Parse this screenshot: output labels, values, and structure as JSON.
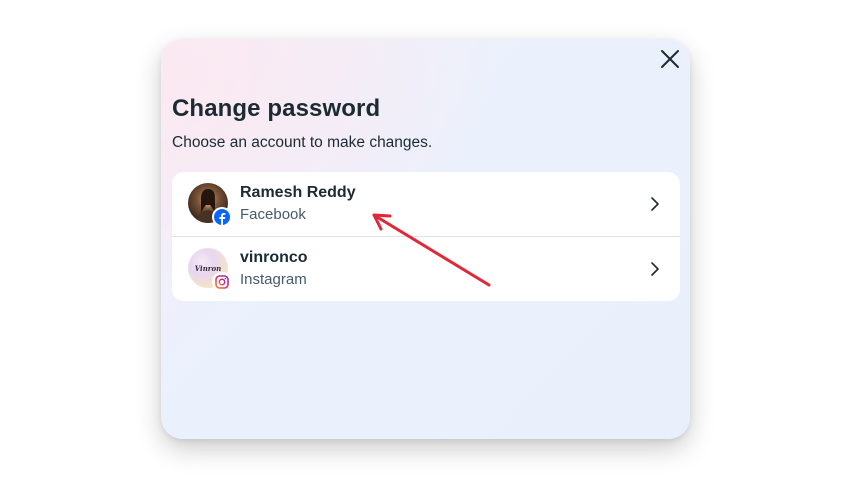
{
  "dialog": {
    "title": "Change password",
    "subtitle": "Choose an account to make changes.",
    "close_icon": "close-icon"
  },
  "accounts": [
    {
      "name": "Ramesh Reddy",
      "platform": "Facebook",
      "badge_icon": "facebook-icon",
      "avatar": "profile-photo"
    },
    {
      "name": "vinronco",
      "platform": "Instagram",
      "badge_icon": "instagram-icon",
      "avatar": "profile-photo",
      "avatar_text": "Vinron"
    }
  ],
  "annotation": {
    "type": "arrow",
    "color": "#e0283a",
    "points_to": "accounts.0.platform"
  },
  "colors": {
    "facebook_blue": "#0866ff",
    "instagram_pink": "#d6249f",
    "text_primary": "#1c2b33",
    "text_secondary": "#465a69"
  }
}
